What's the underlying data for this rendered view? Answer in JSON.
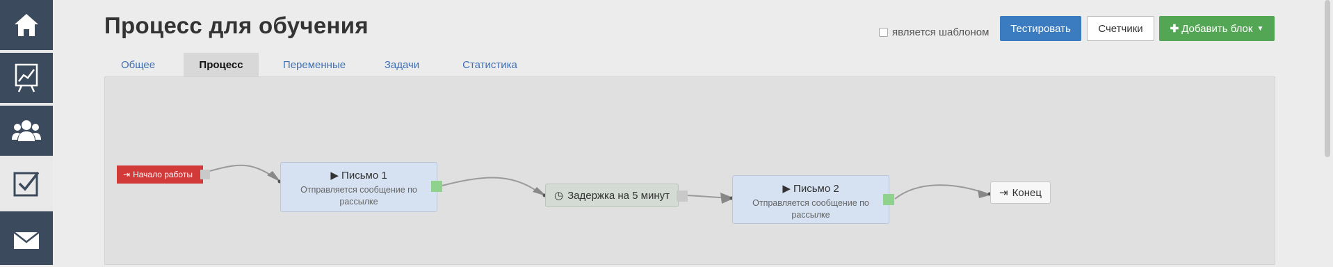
{
  "sidebar": {
    "items": [
      {
        "icon": "home-icon"
      },
      {
        "icon": "chart-icon"
      },
      {
        "icon": "users-icon"
      },
      {
        "icon": "checkbox-icon",
        "active": true
      },
      {
        "icon": "mail-icon"
      }
    ]
  },
  "header": {
    "title": "Процесс для обучения",
    "template_checkbox_label": "является шаблоном",
    "test_button": "Тестировать",
    "counters_button": "Счетчики",
    "add_block_button": "Добавить блок"
  },
  "tabs": [
    {
      "label": "Общее"
    },
    {
      "label": "Процесс",
      "active": true
    },
    {
      "label": "Переменные"
    },
    {
      "label": "Задачи"
    },
    {
      "label": "Статистика"
    }
  ],
  "flow": {
    "start": {
      "label": "Начало работы"
    },
    "letter1": {
      "title": "▶ Письмо 1",
      "description": "Отправляется сообщение по рассылке"
    },
    "delay": {
      "label": "Задержка на 5 минут"
    },
    "letter2": {
      "title": "▶ Письмо 2",
      "description": "Отправляется сообщение по рассылке"
    },
    "end": {
      "label": "Конец"
    }
  },
  "colors": {
    "sidebar_bg": "#3b4a5c",
    "start_node": "#d23a3a",
    "mail_node": "#d6e2f2",
    "success_port": "#8ed28e",
    "primary_button": "#3b7bbf",
    "add_button": "#53a653"
  }
}
